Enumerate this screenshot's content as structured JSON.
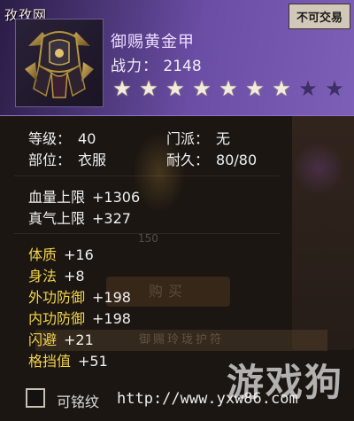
{
  "watermark_top": "孜孜网",
  "tradable_badge": "不可交易",
  "item": {
    "name": "御赐黄金甲",
    "power_label": "战力：",
    "power_value": "2148",
    "stars_total": 9,
    "stars_filled": 7
  },
  "basic": [
    {
      "label": "等级：",
      "value": "40"
    },
    {
      "label": "门派：",
      "value": "无"
    },
    {
      "label": "部位：",
      "value": "衣服"
    },
    {
      "label": "耐久：",
      "value": "80/80"
    }
  ],
  "limits": [
    {
      "label": "血量上限",
      "value": "+1306"
    },
    {
      "label": "真气上限",
      "value": "+327"
    }
  ],
  "attributes": [
    {
      "label": "体质",
      "value": "+16"
    },
    {
      "label": "身法",
      "value": "+8"
    },
    {
      "label": "外功防御",
      "value": "+198"
    },
    {
      "label": "内功防御",
      "value": "+198"
    },
    {
      "label": "闪避",
      "value": "+21"
    },
    {
      "label": "格挡值",
      "value": "+51"
    }
  ],
  "background": {
    "price": "150",
    "buy": "购买",
    "banner": "御赐玲珑护符"
  },
  "footer": {
    "engrave_label": "可铭纹",
    "url": "http://www.yxw86.com",
    "watermark": "游戏狗"
  },
  "colors": {
    "header_gradient_start": "#2a1d46",
    "header_gradient_end": "#7d5fb8",
    "attribute_label": "#f2d44a",
    "star_on": "#f2ecdc",
    "star_off": "#3c2f63"
  }
}
